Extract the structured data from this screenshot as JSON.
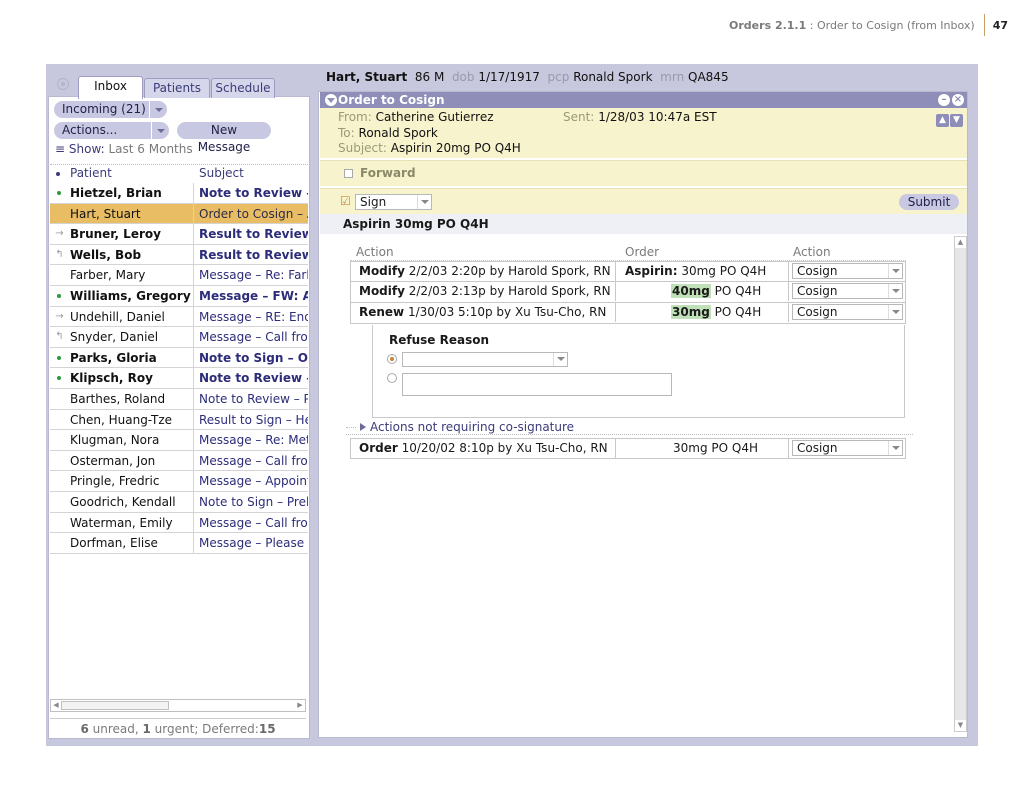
{
  "page_header": {
    "section": "Orders 2.1.1",
    "title": " : Order to Cosign (from Inbox)",
    "page_number": "47"
  },
  "left": {
    "tabs": [
      "Inbox",
      "Patients",
      "Schedule"
    ],
    "incoming_label": "Incoming (21)",
    "actions_label": "Actions...",
    "new_message_label": "New Message",
    "show_label": "Show:",
    "show_value": "Last 6 Months",
    "columns": {
      "patient": "Patient",
      "subject": "Subject"
    },
    "rows": [
      {
        "patient": "Hietzel, Brian",
        "subject": "Note to Review – V",
        "unread": true,
        "indicator": "dot"
      },
      {
        "patient": "Hart, Stuart",
        "subject": "Order to Cosign – A",
        "unread": false,
        "indicator": "",
        "selected": true
      },
      {
        "patient": "Bruner, Leroy",
        "subject": "Result to Review – ",
        "unread": true,
        "indicator": "forward-icon"
      },
      {
        "patient": "Wells, Bob",
        "subject": "Result to Review – ",
        "unread": true,
        "indicator": "reply-icon"
      },
      {
        "patient": "Farber, Mary",
        "subject": "Message – Re: Farb",
        "unread": false,
        "indicator": ""
      },
      {
        "patient": "Williams, Gregory",
        "subject": "Message – FW: Abr",
        "unread": true,
        "indicator": "dot"
      },
      {
        "patient": "Undehill, Daniel",
        "subject": "Message – RE: End",
        "unread": false,
        "indicator": "forward-icon"
      },
      {
        "patient": "Snyder, Daniel",
        "subject": "Message – Call fron",
        "unread": false,
        "indicator": "reply-icon"
      },
      {
        "patient": "Parks, Gloria",
        "subject": "Note to Sign – OP N",
        "unread": true,
        "indicator": "dot"
      },
      {
        "patient": "Klipsch, Roy",
        "subject": "Note to Review – P",
        "unread": true,
        "indicator": "dot"
      },
      {
        "patient": "Barthes, Roland",
        "subject": "Note to Review – Pr",
        "unread": false,
        "indicator": ""
      },
      {
        "patient": "Chen, Huang-Tze",
        "subject": "Result to Sign – Her",
        "unread": false,
        "indicator": ""
      },
      {
        "patient": "Klugman, Nora",
        "subject": "Message – Re: Met",
        "unread": false,
        "indicator": ""
      },
      {
        "patient": "Osterman, Jon",
        "subject": "Message – Call fron",
        "unread": false,
        "indicator": ""
      },
      {
        "patient": "Pringle, Fredric",
        "subject": "Message – Appoint",
        "unread": false,
        "indicator": ""
      },
      {
        "patient": "Goodrich, Kendall",
        "subject": "Note to Sign – Preli",
        "unread": false,
        "indicator": ""
      },
      {
        "patient": "Waterman, Emily",
        "subject": "Message – Call fron",
        "unread": false,
        "indicator": ""
      },
      {
        "patient": "Dorfman, Elise",
        "subject": "Message – Please r",
        "unread": false,
        "indicator": ""
      }
    ],
    "status": {
      "unread_count": "6",
      "unread_label": " unread, ",
      "urgent_count": "1",
      "urgent_label": " urgent;  Deferred:",
      "deferred_count": "15"
    }
  },
  "patient_header": {
    "name": "Hart, Stuart",
    "age_sex": "86 M",
    "dob_label": "dob",
    "dob": "1/17/1917",
    "pcp_label": "pcp",
    "pcp": "Ronald Spork",
    "mrn_label": "mrn",
    "mrn": "QA845"
  },
  "panel": {
    "title": "Order to Cosign",
    "from_label": "From:",
    "from": "Catherine Gutierrez",
    "sent_label": "Sent:",
    "sent": "1/28/03 10:47a EST",
    "to_label": "To:",
    "to": "Ronald Spork",
    "subject_label": "Subject:",
    "subject": "Aspirin 20mg PO Q4H",
    "forward_label": "Forward",
    "sign_value": "Sign",
    "submit_label": "Submit",
    "order_title": "Aspirin 30mg PO Q4H",
    "columns": {
      "action": "Action",
      "order": "Order",
      "action2": "Action"
    },
    "orders": [
      {
        "verb": "Modify",
        "detail": " 2/2/03 2:20p by Harold Spork, RN",
        "order_prefix": "Aspirin:",
        "order_hl": "",
        "order_rest": " 30mg PO Q4H",
        "action": "Cosign"
      },
      {
        "verb": "Modify",
        "detail": " 2/2/03 2:13p by Harold Spork, RN",
        "order_prefix": "",
        "order_hl": "40mg",
        "order_rest": " PO Q4H",
        "action": "Cosign"
      },
      {
        "verb": "Renew",
        "detail": " 1/30/03 5:10p by Xu Tsu-Cho, RN",
        "order_prefix": "",
        "order_hl": "30mg",
        "order_rest": " PO Q4H",
        "action": "Cosign"
      }
    ],
    "refuse_reason_label": "Refuse Reason",
    "expander_label": "Actions not requiring co-signature",
    "other_orders": [
      {
        "verb": "Order",
        "detail": " 10/20/02 8:10p by Xu Tsu-Cho, RN",
        "order_rest": "30mg PO Q4H",
        "action": "Cosign"
      }
    ]
  }
}
